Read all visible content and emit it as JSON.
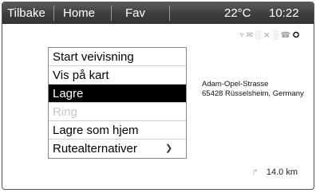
{
  "topbar": {
    "back_label": "Tilbake",
    "home_label": "Home",
    "fav_label": "Fav",
    "temperature": "22°C",
    "time": "10:22"
  },
  "status_icons": [
    "wifi-icon",
    "mail-icon",
    "signal-icon",
    "shuffle-icon",
    "signal-weak-icon",
    "phone-icon",
    "bluetooth-icon"
  ],
  "menu": {
    "items": [
      {
        "label": "Start veivisning",
        "state": "normal"
      },
      {
        "label": "Vis på kart",
        "state": "normal"
      },
      {
        "label": "Lagre",
        "state": "selected"
      },
      {
        "label": "Ring",
        "state": "disabled"
      },
      {
        "label": "Lagre som hjem",
        "state": "normal"
      },
      {
        "label": "Rutealternativer",
        "state": "normal",
        "submenu": true
      }
    ]
  },
  "address": {
    "line1": "Adam-Opel-Strasse",
    "line2": "65428 Rüsselsheim, Germany"
  },
  "distance": {
    "value": "14.0 km",
    "icon": "route-arrow-icon"
  }
}
